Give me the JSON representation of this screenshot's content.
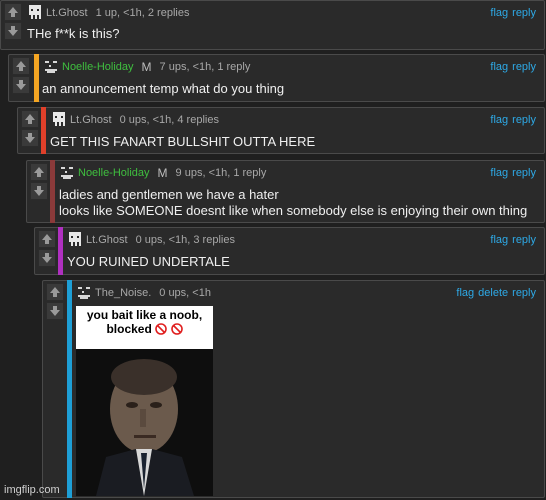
{
  "comments": [
    {
      "username": "Lt.Ghost",
      "meta": "1 up, <1h, 2 replies",
      "text": "THe f**k is this?",
      "actions": [
        "flag",
        "reply"
      ],
      "accent": ""
    },
    {
      "username": "Noelle-Holiday",
      "badge": "M",
      "meta": "7 ups, <1h, 1 reply",
      "text": "an announcement temp what do you thing",
      "actions": [
        "flag",
        "reply"
      ],
      "accent": "#f5a623"
    },
    {
      "username": "Lt.Ghost",
      "meta": "0 ups, <1h, 4 replies",
      "text": "GET THIS FANART BULLSHIT OUTTA HERE",
      "actions": [
        "flag",
        "reply"
      ],
      "accent": "#e0402a"
    },
    {
      "username": "Noelle-Holiday",
      "badge": "M",
      "meta": "9 ups, <1h, 1 reply",
      "text_lines": [
        "ladies and gentlemen we have a hater",
        "looks like SOMEONE doesnt like when somebody else is enjoying their own thing"
      ],
      "actions": [
        "flag",
        "reply"
      ],
      "accent": "#8b3a3a"
    },
    {
      "username": "Lt.Ghost",
      "meta": "0 ups, <1h, 3 replies",
      "text": "YOU RUINED UNDERTALE",
      "actions": [
        "flag",
        "reply"
      ],
      "accent": "#b030c0"
    },
    {
      "username": "The_Noise.",
      "meta": "0 ups, <1h",
      "actions": [
        "flag",
        "delete",
        "reply"
      ],
      "accent": "#1e9fd6",
      "image": {
        "caption_line1": "you bait like a noob,",
        "caption_line2": "blocked",
        "caption_icons": [
          "no-entry-icon",
          "no-entry-icon"
        ]
      }
    }
  ],
  "watermark": "imgflip.com",
  "colors": {
    "link": "#2ea9e6",
    "moderator_name": "#3fbf3f",
    "text": "#f0f0f0",
    "meta": "#a8a8a8"
  },
  "icons": {
    "upvote": "arrow-up-icon",
    "downvote": "arrow-down-icon",
    "avatar": "pixel-skull-icon"
  }
}
